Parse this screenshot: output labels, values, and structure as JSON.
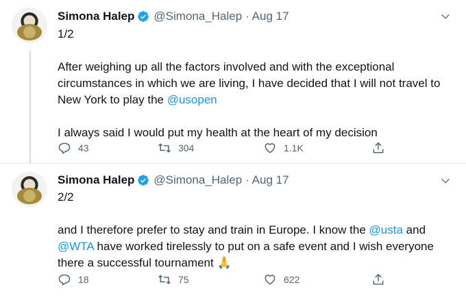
{
  "tweets": [
    {
      "name": "Simona Halep",
      "handle": "@Simona_Halep",
      "date": "· Aug 17",
      "counter": "1/2",
      "line1": "After weighing up all the factors involved and with the exceptional",
      "line2": "circumstances in which we are living, I have decided that I will not travel to",
      "line3_pre": "New York to play the ",
      "line3_link": "@usopen",
      "line4": "I always said I would put my health at the heart of my decision",
      "replies": "43",
      "retweets": "304",
      "likes": "1.1K"
    },
    {
      "name": "Simona Halep",
      "handle": "@Simona_Halep",
      "date": "· Aug 17",
      "counter": "2/2",
      "line1_pre": "and I therefore prefer to stay and train in Europe. I know the ",
      "line1_link": "@usta",
      "line1_post": " and",
      "line2_link": "@WTA",
      "line2_post": " have worked tirelessly to put on a safe event and I wish everyone",
      "line3": "there a successful tournament ",
      "emoji": "🙏",
      "replies": "18",
      "retweets": "75",
      "likes": "622"
    }
  ],
  "icons": {
    "verified": "verified-badge-icon",
    "more": "chevron-down-icon",
    "reply": "reply-icon",
    "retweet": "retweet-icon",
    "like": "heart-icon",
    "share": "share-icon",
    "accent": "#1da1f2",
    "link_color": "#1b95e0"
  }
}
